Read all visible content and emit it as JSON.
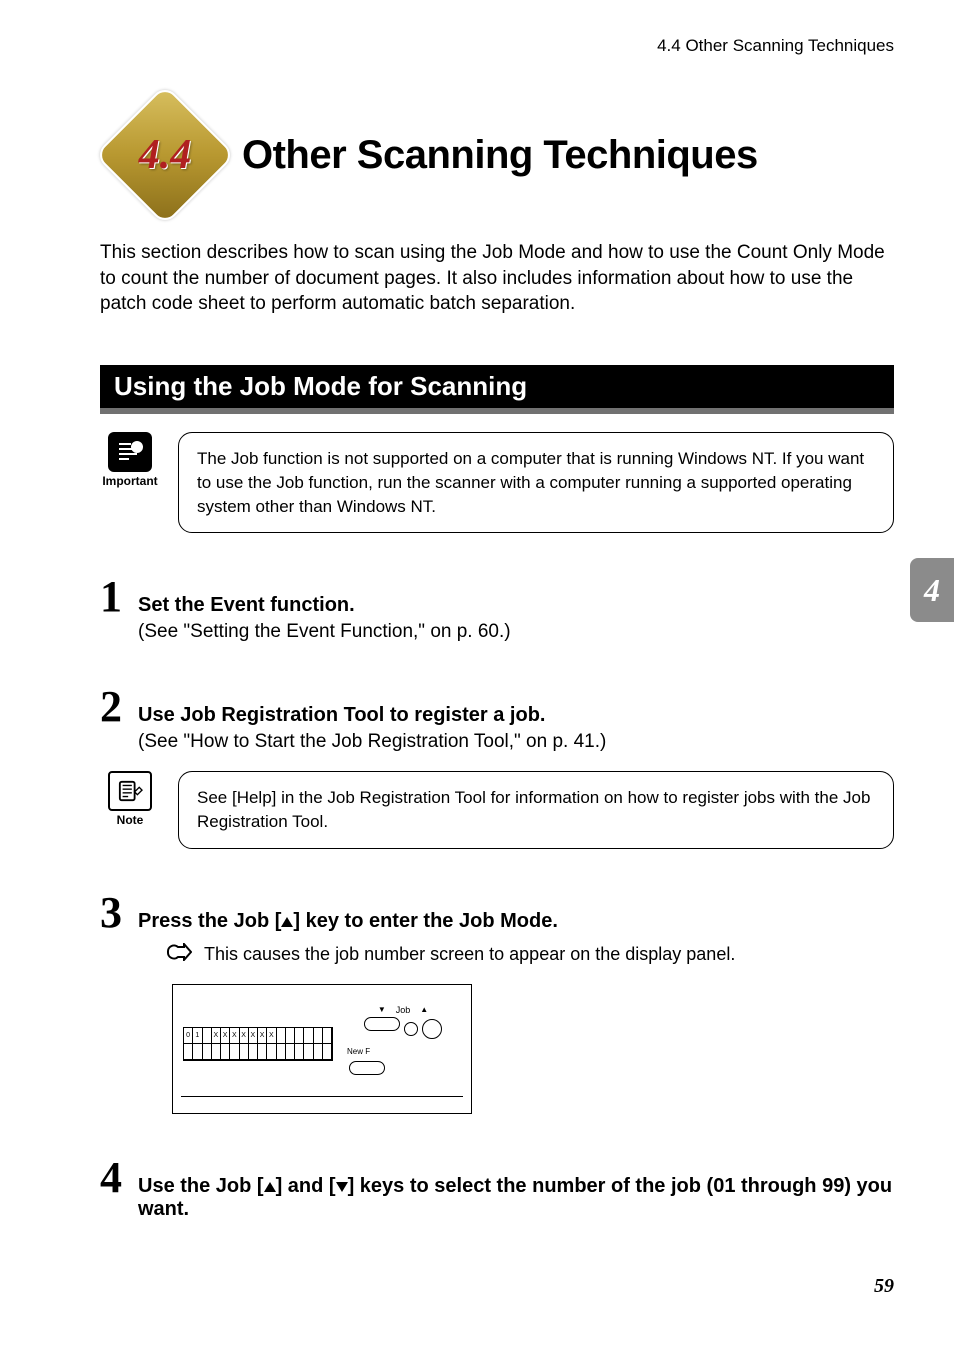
{
  "header": {
    "running": "4.4  Other Scanning Techniques"
  },
  "sidetab": "4",
  "section_number": "4.4",
  "title": "Other Scanning Techniques",
  "intro": "This section describes how to scan using the Job Mode and how to use the Count Only Mode to count the number of document pages. It also includes information about how to use the patch code sheet to perform automatic batch separation.",
  "section_bar": "Using the Job Mode for Scanning",
  "important": {
    "label": "Important",
    "text": "The Job function is not supported on a computer that is running Windows NT. If you want to use the Job function, run the scanner with a computer running a supported operating system other than Windows NT."
  },
  "steps": {
    "s1": {
      "num": "1",
      "head": "Set the Event function.",
      "sub": "(See \"Setting the Event Function,\" on p. 60.)"
    },
    "s2": {
      "num": "2",
      "head": "Use Job Registration Tool to register a job.",
      "sub": "(See \"How to Start the Job Registration Tool,\" on p. 41.)"
    },
    "s3": {
      "num": "3",
      "head_pre": "Press the Job [",
      "head_post": "] key to enter the Job Mode.",
      "result": "This causes the job number screen to appear on the display panel."
    },
    "s4": {
      "num": "4",
      "head_pre": "Use the Job [",
      "head_mid": "] and [",
      "head_post": "] keys to select the number of the job (01 through 99) you want."
    }
  },
  "note": {
    "label": "Note",
    "text": "See [Help] in the Job Registration Tool for information on how to register jobs with the Job Registration Tool."
  },
  "panel": {
    "job_label": "Job",
    "newfile_label": "New F",
    "lcd_row": [
      "0",
      "1",
      " ",
      "X",
      "X",
      "X",
      "X",
      "X",
      "X",
      "X",
      "",
      "",
      "",
      "",
      "",
      ""
    ]
  },
  "page_number": "59"
}
